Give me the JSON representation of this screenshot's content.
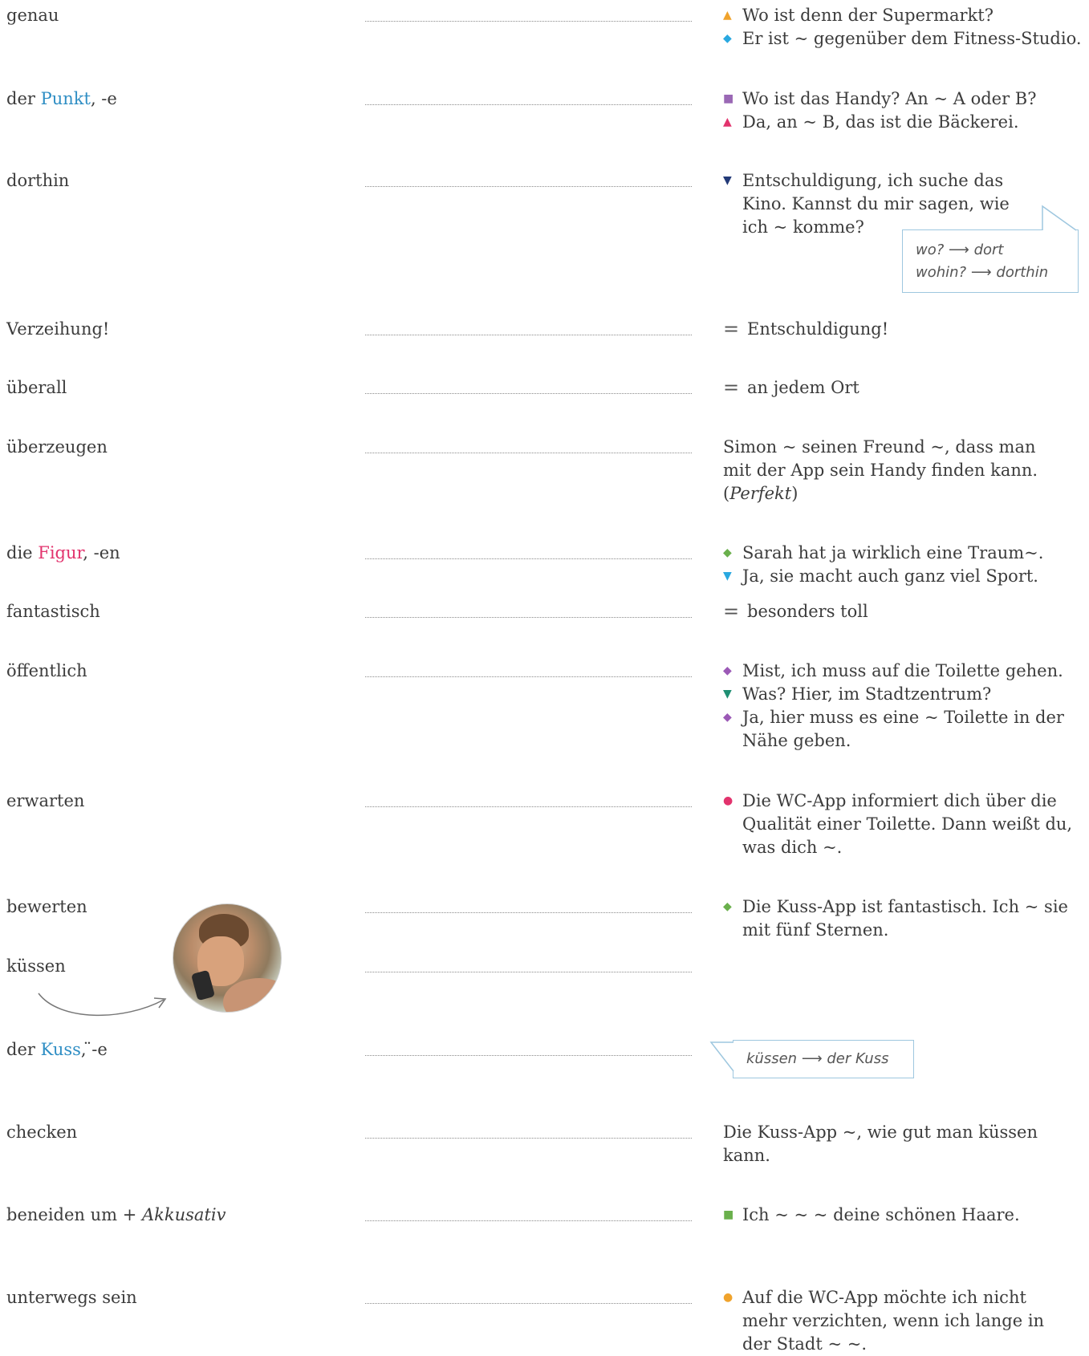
{
  "entries": [
    {
      "pre": "",
      "hl": "",
      "post": "genau",
      "post_it": ""
    },
    {
      "pre": "der ",
      "hl": "Punkt",
      "post": ", -e",
      "post_it": ""
    },
    {
      "pre": "",
      "hl": "",
      "post": "dorthin",
      "post_it": ""
    },
    {
      "pre": "",
      "hl": "",
      "post": "Verzeihung!",
      "post_it": ""
    },
    {
      "pre": "",
      "hl": "",
      "post": "überall",
      "post_it": ""
    },
    {
      "pre": "",
      "hl": "",
      "post": "überzeugen",
      "post_it": ""
    },
    {
      "pre": "die ",
      "hl": "Figur",
      "post": ", -en",
      "post_it": ""
    },
    {
      "pre": "",
      "hl": "",
      "post": "fantastisch",
      "post_it": ""
    },
    {
      "pre": "",
      "hl": "",
      "post": "öffentlich",
      "post_it": ""
    },
    {
      "pre": "",
      "hl": "",
      "post": "erwarten",
      "post_it": ""
    },
    {
      "pre": "",
      "hl": "",
      "post": "bewerten",
      "post_it": ""
    },
    {
      "pre": "",
      "hl": "",
      "post": "küssen",
      "post_it": ""
    },
    {
      "pre": "der ",
      "hl": "Kuss",
      "post": ", ̈-e",
      "post_it": ""
    },
    {
      "pre": "",
      "hl": "",
      "post": "checken",
      "post_it": ""
    },
    {
      "pre": "",
      "hl": "",
      "post": "beneiden um + ",
      "post_it": "Akkusativ"
    },
    {
      "pre": "",
      "hl": "",
      "post": "unterwegs sein",
      "post_it": ""
    }
  ],
  "examples": {
    "genau": [
      "Wo ist denn der Supermarkt?",
      "Er ist ~ gegenüber dem Fitness-Studio."
    ],
    "punkt": [
      "Wo ist das Handy? An ~ A oder B?",
      "Da, an ~ B, das ist die Bäckerei."
    ],
    "dorthin": [
      "Entschuldigung, ich suche das",
      "Kino. Kannst du mir sagen, wie",
      "ich ~ komme?"
    ],
    "verzeihung": "Entschuldigung!",
    "ueberall": "an jedem Ort",
    "ueberzeugen": [
      "Simon ~ seinen Freund ~, dass man",
      "mit der App sein Handy finden kann."
    ],
    "ueberzeugen_paren_open": "(",
    "ueberzeugen_perfekt": "Perfekt",
    "ueberzeugen_paren_close": ")",
    "figur": [
      "Sarah hat ja wirklich eine Traum~.",
      "Ja, sie macht auch ganz viel Sport."
    ],
    "fantastisch": "besonders toll",
    "oeffentlich": [
      "Mist, ich muss auf die Toilette gehen.",
      "Was? Hier, im Stadtzentrum?",
      "Ja, hier muss es eine ~ Toilette in der",
      "Nähe geben."
    ],
    "erwarten": [
      "Die WC-App informiert dich über die",
      "Qualität einer Toilette. Dann weißt du,",
      "was dich ~."
    ],
    "bewerten": [
      "Die Kuss-App ist fantastisch. Ich ~ sie",
      "mit fünf Sternen."
    ],
    "checken": [
      "Die Kuss-App ~, wie gut man küssen",
      "kann."
    ],
    "beneiden": "Ich ~ ~ ~ deine schönen Haare.",
    "unterwegs": [
      "Auf die WC-App möchte ich nicht",
      "mehr verzichten, wenn ich lange in",
      "der Stadt ~ ~."
    ]
  },
  "notes": {
    "wo_q": "wo?",
    "wo_a": "dort",
    "wohin_q": "wohin?",
    "wohin_a": "dorthin",
    "kuss_from": "küssen",
    "kuss_to": "der Kuss"
  },
  "colors": {
    "orange": "#f0a32c",
    "blue": "#2f8ec4",
    "cyan": "#29a8e0",
    "purple": "#9a68b5",
    "red": "#e2336d",
    "navy": "#233a78",
    "green": "#6ab04c",
    "teal": "#1f8f73",
    "violet": "#9b59b6",
    "pink": "#e2336d",
    "note_border": "#9ec7df"
  },
  "icons": [
    "triangle-up-icon",
    "diamond-icon",
    "square-icon",
    "triangle-down-icon",
    "circle-icon",
    "equals-icon",
    "arrow-right-icon",
    "curved-arrow-icon"
  ]
}
